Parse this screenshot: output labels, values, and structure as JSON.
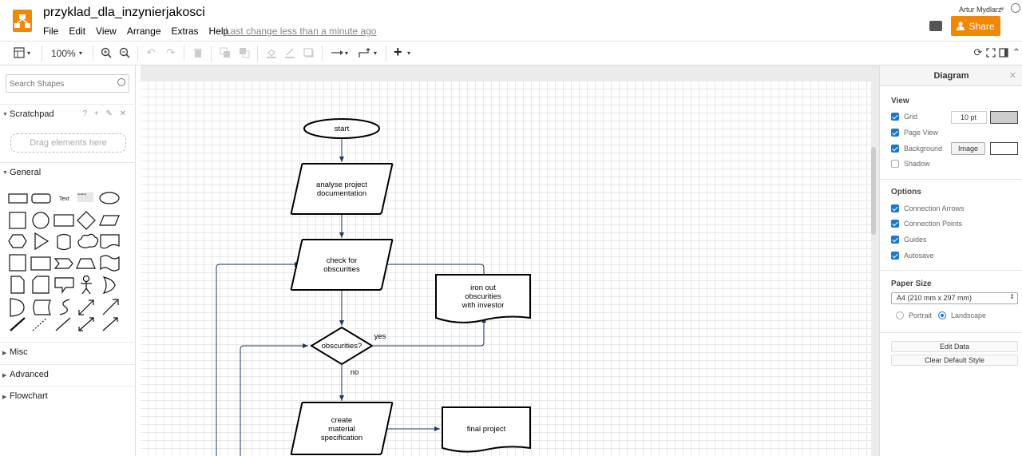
{
  "header": {
    "title": "przyklad_dla_inzynierjakosci",
    "menu": [
      "File",
      "Edit",
      "View",
      "Arrange",
      "Extras",
      "Help"
    ],
    "last_change": "Last change less than a minute ago",
    "user_name": "Artur Mydlarz",
    "share_label": "Share"
  },
  "toolbar": {
    "zoom": "100%"
  },
  "left_panel": {
    "search_placeholder": "Search Shapes",
    "scratchpad": {
      "label": "Scratchpad",
      "tools": "? + ✎ ✕",
      "drag_hint": "Drag elements here"
    },
    "general_label": "General",
    "sections": [
      "Misc",
      "Advanced",
      "Flowchart"
    ],
    "shape_text_label": "Text",
    "shape_heading_label": "Heading"
  },
  "diagram": {
    "nodes": {
      "start": "start",
      "analyse": [
        "analyse project",
        "documentation"
      ],
      "check": [
        "check for",
        "obscurities"
      ],
      "decision": "obscurities?",
      "iron": [
        "iron out",
        "obscurities",
        "with investor"
      ],
      "create": [
        "create",
        "material",
        "specification"
      ],
      "final": "final project"
    },
    "edge_labels": {
      "yes": "yes",
      "no": "no"
    }
  },
  "right_panel": {
    "title": "Diagram",
    "view_header": "View",
    "view_options": [
      {
        "label": "Grid",
        "checked": true
      },
      {
        "label": "Page View",
        "checked": true
      },
      {
        "label": "Background",
        "checked": true
      },
      {
        "label": "Shadow",
        "checked": false
      }
    ],
    "grid_size": "10 pt",
    "image_button": "Image",
    "options_header": "Options",
    "options": [
      {
        "label": "Connection Arrows",
        "checked": true
      },
      {
        "label": "Connection Points",
        "checked": true
      },
      {
        "label": "Guides",
        "checked": true
      },
      {
        "label": "Autosave",
        "checked": true
      }
    ],
    "paper_size_header": "Paper Size",
    "paper_size": "A4 (210 mm x 297 mm)",
    "orientation": [
      {
        "label": "Portrait",
        "selected": false
      },
      {
        "label": "Landscape",
        "selected": true
      }
    ],
    "edit_data_button": "Edit Data",
    "clear_style_button": "Clear Default Style"
  },
  "colors": {
    "accent": "#f08705",
    "checkbox": "#1976d2",
    "connector": "#1e3a5f"
  }
}
